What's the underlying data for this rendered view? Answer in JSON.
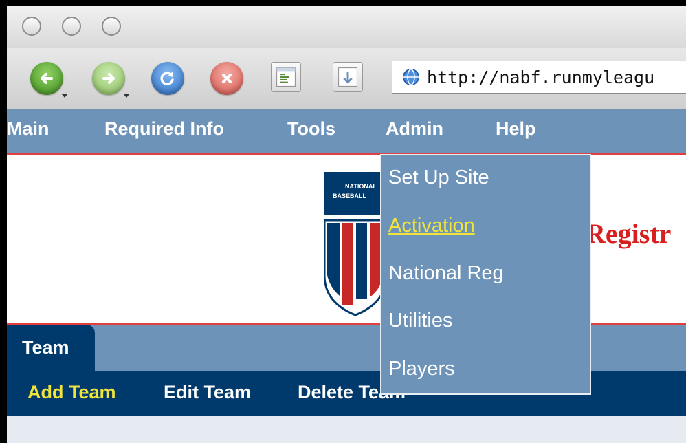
{
  "window": {
    "title_lights": [
      "close",
      "minimize",
      "zoom"
    ]
  },
  "toolbar": {
    "back_icon": "back-arrow-icon",
    "forward_icon": "forward-arrow-icon",
    "reload_icon": "reload-icon",
    "stop_icon": "stop-icon",
    "url": "http://nabf.runmyleagu",
    "colors": {
      "back": "#5aa832",
      "forward": "#a4d27a",
      "reload": "#3f86d8",
      "stop": "#e5736b"
    }
  },
  "menu": {
    "items": [
      "Main",
      "Required Info",
      "Tools",
      "Admin",
      "Help"
    ],
    "background": "#6e93b8",
    "accent": "#e24040"
  },
  "admin_dropdown": {
    "items": [
      "Set Up Site",
      "Activation",
      "National Reg",
      "Utilities",
      "Players"
    ],
    "active": "Activation",
    "active_color": "#f0e43a"
  },
  "banner": {
    "logo_text_line1": "NATIONAL",
    "logo_text_line2": "BASEBALL",
    "title": "Registr"
  },
  "tabs": {
    "active": "Team"
  },
  "subnav": {
    "items": [
      "Add Team",
      "Edit Team",
      "Delete Team"
    ],
    "active": "Add Team",
    "active_color": "#f0e43a"
  }
}
